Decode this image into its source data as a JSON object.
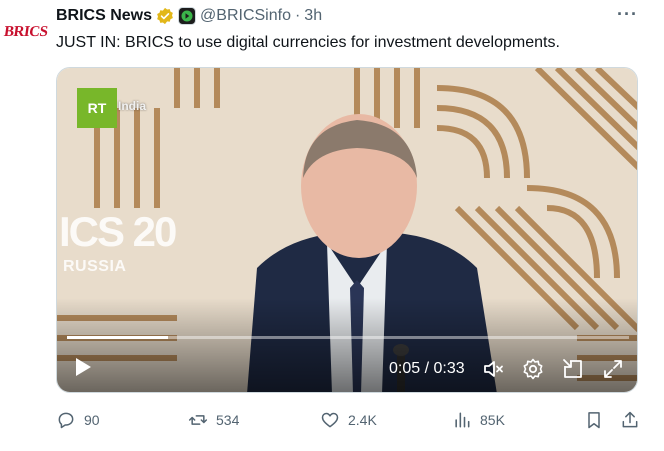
{
  "author": {
    "avatar_text": "BRICS",
    "name": "BRICS News",
    "handle": "@BRICSinfo",
    "dot": "·",
    "time": "3h"
  },
  "tweet": {
    "text": "JUST IN: BRICS to use digital currencies for investment developments."
  },
  "video": {
    "channel_logo": "RT",
    "channel_sub": "India",
    "backdrop_text": "ICS 20",
    "backdrop_sub": "RUSSIA",
    "time_display": "0:05 / 0:33",
    "progress": 0.18
  },
  "actions": {
    "replies": "90",
    "reposts": "534",
    "likes": "2.4K",
    "views": "85K"
  },
  "colors": {
    "text_primary": "#0f1419",
    "text_secondary": "#536471",
    "verified_gold": "#e2b719",
    "rt_green": "#78b72a",
    "backdrop_bg": "#e8dccb",
    "backdrop_stripe": "#b48a5b"
  }
}
